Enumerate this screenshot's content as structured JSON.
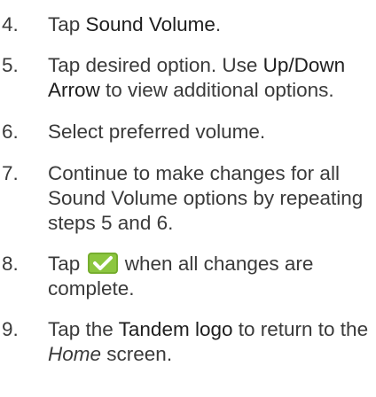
{
  "steps": [
    {
      "num": "4.",
      "parts": [
        "Tap ",
        "Sound Volume",
        "."
      ]
    },
    {
      "num": "5.",
      "parts": [
        "Tap desired option. Use ",
        "Up/Down Arrow",
        " to view additional options."
      ]
    },
    {
      "num": "6.",
      "parts": [
        "Select preferred volume."
      ]
    },
    {
      "num": "7.",
      "parts": [
        "Continue to make changes for all Sound Volume options by repeating steps 5 and 6."
      ]
    },
    {
      "num": "8.",
      "parts": [
        "Tap ",
        " when all changes are complete."
      ],
      "icon": "check-save-icon"
    },
    {
      "num": "9.",
      "parts": [
        "Tap the ",
        "Tandem logo",
        " to return to the ",
        "Home",
        " screen."
      ]
    }
  ],
  "colors": {
    "text": "#3a3a3a",
    "check_button": "#8cc63f",
    "check_mark": "#ffffff"
  }
}
